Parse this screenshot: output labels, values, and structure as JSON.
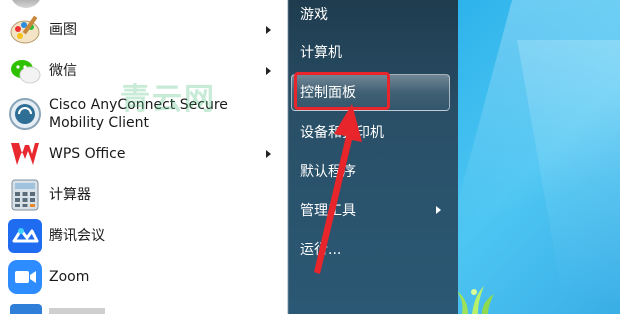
{
  "programs": [
    {
      "label": "画图",
      "icon": "paint-icon",
      "has_submenu": true
    },
    {
      "label": "微信",
      "icon": "wechat-icon",
      "has_submenu": true
    },
    {
      "label_line1": "Cisco AnyConnect Secure",
      "label_line2": "Mobility Client",
      "icon": "cisco-anyconnect-icon",
      "has_submenu": false
    },
    {
      "label": "WPS Office",
      "icon": "wps-icon",
      "has_submenu": true
    },
    {
      "label": "计算器",
      "icon": "calculator-icon",
      "has_submenu": false
    },
    {
      "label": "腾讯会议",
      "icon": "tencent-meeting-icon",
      "has_submenu": false
    },
    {
      "label": "Zoom",
      "icon": "zoom-icon",
      "has_submenu": false
    }
  ],
  "right_menu": [
    {
      "label": "游戏"
    },
    {
      "label": "计算机"
    },
    {
      "label": "控制面板",
      "highlighted": true
    },
    {
      "label": "设备和打印机"
    },
    {
      "label": "默认程序"
    },
    {
      "label": "管理工具",
      "has_submenu": true
    },
    {
      "label": "运行..."
    }
  ],
  "watermark": "青云网",
  "colors": {
    "annotation": "#e8252a",
    "menu_dark": "#2a5068",
    "desktop": "#28b0ea"
  }
}
